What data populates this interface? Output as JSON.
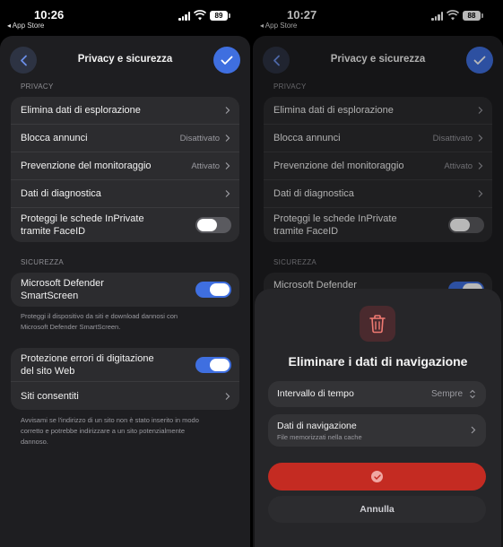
{
  "left": {
    "status": {
      "time": "10:26",
      "back_app": "◂ App Store",
      "battery": "89"
    },
    "nav": {
      "title": "Privacy e sicurezza"
    },
    "privacy": {
      "label": "PRIVACY",
      "rows": {
        "clear_browsing": "Elimina dati di esplorazione",
        "block_ads": "Blocca annunci",
        "block_ads_value": "Disattivato",
        "tracking": "Prevenzione del monitoraggio",
        "tracking_value": "Attivato",
        "diagnostics": "Dati di diagnostica",
        "inprivate_l1": "Proteggi le schede InPrivate",
        "inprivate_l2": "tramite FaceID"
      }
    },
    "security": {
      "label": "SICUREZZA",
      "smartscreen_l1": "Microsoft Defender",
      "smartscreen_l2": "SmartScreen",
      "smartscreen_note_l1": "Proteggi il dispositivo da siti e download dannosi con",
      "smartscreen_note_l2": "Microsoft Defender SmartScreen.",
      "typo_l1": "Protezione errori di digitazione",
      "typo_l2": "del sito Web",
      "allowed_sites": "Siti consentiti",
      "typo_note_l1": "Avvisami se l'indirizzo di un sito non è stato inserito in modo",
      "typo_note_l2": "corretto e potrebbe indirizzare a un sito potenzialmente",
      "typo_note_l3": "dannoso."
    },
    "toggles": {
      "inprivate": false,
      "smartscreen": true,
      "typo": true
    }
  },
  "right": {
    "status": {
      "time": "10:27",
      "back_app": "◂ App Store",
      "battery": "88"
    },
    "nav": {
      "title": "Privacy e sicurezza"
    },
    "privacy": {
      "label": "PRIVACY",
      "clear_browsing": "Elimina dati di esplorazione",
      "block_ads": "Blocca annunci",
      "block_ads_value": "Disattivato",
      "tracking": "Prevenzione del monitoraggio",
      "tracking_value": "Attivato",
      "diagnostics": "Dati di diagnostica",
      "inprivate_l1": "Proteggi le schede InPrivate",
      "inprivate_l2": "tramite FaceID"
    },
    "security": {
      "label": "SICUREZZA",
      "smartscreen_l1": "Microsoft Defender"
    },
    "modal": {
      "title": "Eliminare i dati di navigazione",
      "time_range_label": "Intervallo di tempo",
      "time_range_value": "Sempre",
      "data_label": "Dati di navigazione",
      "data_sub": "File memorizzati nella cache",
      "cancel": "Annulla"
    }
  },
  "icons": {
    "back": "chevron-left-icon",
    "confirm": "checkmark-icon",
    "trash": "trash-icon",
    "row_chevron": "chevron-right-icon",
    "updown": "chevron-up-down-icon"
  },
  "colors": {
    "accent_blue": "#3f6fe0",
    "delete_red": "#c42b22",
    "sheet_bg": "#1e1e21",
    "group_bg": "#2c2c2f"
  }
}
